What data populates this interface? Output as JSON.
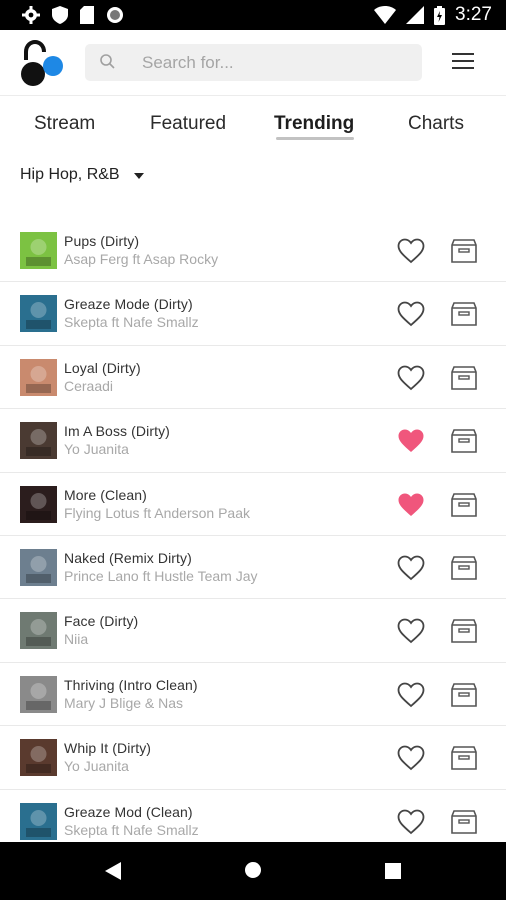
{
  "status_bar": {
    "time": "3:27"
  },
  "header": {
    "search_placeholder": "Search for..."
  },
  "tabs": [
    {
      "label": "Stream",
      "active": false
    },
    {
      "label": "Featured",
      "active": false
    },
    {
      "label": "Trending",
      "active": true
    },
    {
      "label": "Charts",
      "active": false
    }
  ],
  "genre_filter": {
    "label": "Hip Hop, R&B"
  },
  "colors": {
    "accent_heart": "#f0567c",
    "text_primary": "#333333",
    "text_secondary": "#a8a8a8"
  },
  "tracks": [
    {
      "title": "Pups  (Dirty)",
      "artist": "Asap Ferg ft Asap Rocky",
      "liked": false,
      "art_color": "#7cc242"
    },
    {
      "title": "Greaze Mode  (Dirty)",
      "artist": "Skepta ft Nafe Smallz",
      "liked": false,
      "art_color": "#2a6f8f"
    },
    {
      "title": "Loyal  (Dirty)",
      "artist": "Ceraadi",
      "liked": false,
      "art_color": "#c98a6e"
    },
    {
      "title": "Im A Boss  (Dirty)",
      "artist": "Yo Juanita",
      "liked": true,
      "art_color": "#4a3a32"
    },
    {
      "title": "More  (Clean)",
      "artist": "Flying Lotus ft Anderson Paak",
      "liked": true,
      "art_color": "#2b1d1d"
    },
    {
      "title": "Naked  (Remix Dirty)",
      "artist": "Prince Lano ft Hustle Team Jay",
      "liked": false,
      "art_color": "#6d7f8f"
    },
    {
      "title": "Face  (Dirty)",
      "artist": "Niia",
      "liked": false,
      "art_color": "#6f7a72"
    },
    {
      "title": "Thriving  (Intro Clean)",
      "artist": "Mary J Blige & Nas",
      "liked": false,
      "art_color": "#8a8a8a"
    },
    {
      "title": "Whip It  (Dirty)",
      "artist": "Yo Juanita",
      "liked": false,
      "art_color": "#5a3a2e"
    },
    {
      "title": "Greaze Mod  (Clean)",
      "artist": "Skepta ft Nafe Smallz",
      "liked": false,
      "art_color": "#2a6f8f"
    }
  ]
}
